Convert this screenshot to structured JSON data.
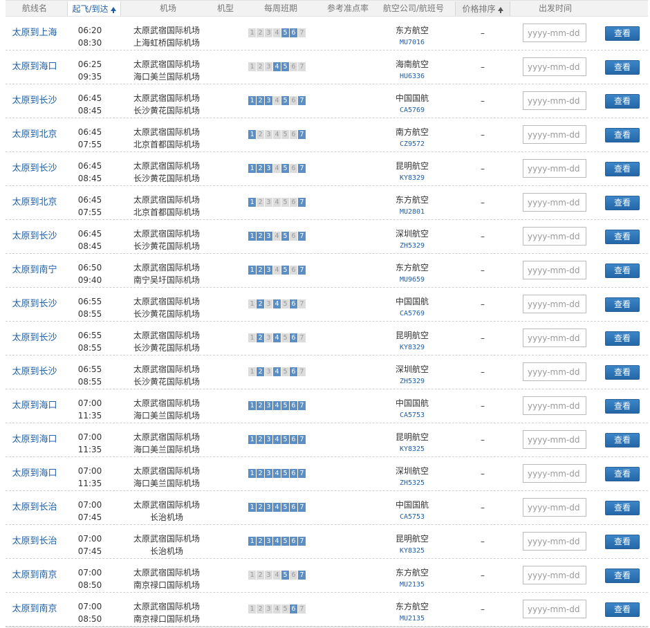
{
  "header": {
    "route": "航线名",
    "depart_arrive": "起飞/到达",
    "airport": "机场",
    "aircraft": "机型",
    "weekly": "每周班期",
    "ontime": "参考准点率",
    "airline_flight": "航空公司/航班号",
    "price_sort": "价格排序",
    "depart_date": "出发时间"
  },
  "date_placeholder": "yyyy-mm-dd",
  "view_label": "查看",
  "colors": {
    "link": "#1f5fa5",
    "day_on": "#5a8ec4",
    "day_off": "#dcdcdc",
    "button": "#2b6fb0"
  },
  "rows": [
    {
      "route": "太原到上海",
      "dep": "06:20",
      "arr": "08:30",
      "from": "太原武宿国际机场",
      "to": "上海虹桥国际机场",
      "days": [
        0,
        0,
        0,
        0,
        1,
        1,
        0
      ],
      "airline": "东方航空",
      "flight": "MU7016",
      "price": "–"
    },
    {
      "route": "太原到海口",
      "dep": "06:25",
      "arr": "09:35",
      "from": "太原武宿国际机场",
      "to": "海口美兰国际机场",
      "days": [
        0,
        0,
        0,
        1,
        1,
        0,
        0
      ],
      "airline": "海南航空",
      "flight": "HU6336",
      "price": "–"
    },
    {
      "route": "太原到长沙",
      "dep": "06:45",
      "arr": "08:45",
      "from": "太原武宿国际机场",
      "to": "长沙黄花国际机场",
      "days": [
        1,
        1,
        1,
        0,
        1,
        0,
        1
      ],
      "airline": "中国国航",
      "flight": "CA5769",
      "price": "–"
    },
    {
      "route": "太原到北京",
      "dep": "06:45",
      "arr": "07:55",
      "from": "太原武宿国际机场",
      "to": "北京首都国际机场",
      "days": [
        1,
        0,
        0,
        0,
        0,
        0,
        1
      ],
      "airline": "南方航空",
      "flight": "CZ9572",
      "price": "–"
    },
    {
      "route": "太原到长沙",
      "dep": "06:45",
      "arr": "08:45",
      "from": "太原武宿国际机场",
      "to": "长沙黄花国际机场",
      "days": [
        1,
        1,
        1,
        0,
        1,
        0,
        1
      ],
      "airline": "昆明航空",
      "flight": "KY8329",
      "price": "–"
    },
    {
      "route": "太原到北京",
      "dep": "06:45",
      "arr": "07:55",
      "from": "太原武宿国际机场",
      "to": "北京首都国际机场",
      "days": [
        1,
        0,
        0,
        0,
        0,
        0,
        1
      ],
      "airline": "东方航空",
      "flight": "MU2801",
      "price": "–"
    },
    {
      "route": "太原到长沙",
      "dep": "06:45",
      "arr": "08:45",
      "from": "太原武宿国际机场",
      "to": "长沙黄花国际机场",
      "days": [
        1,
        1,
        1,
        0,
        1,
        0,
        1
      ],
      "airline": "深圳航空",
      "flight": "ZH5329",
      "price": "–"
    },
    {
      "route": "太原到南宁",
      "dep": "06:50",
      "arr": "09:40",
      "from": "太原武宿国际机场",
      "to": "南宁吴圩国际机场",
      "days": [
        1,
        1,
        1,
        0,
        1,
        0,
        1
      ],
      "airline": "东方航空",
      "flight": "MU9659",
      "price": "–"
    },
    {
      "route": "太原到长沙",
      "dep": "06:55",
      "arr": "08:55",
      "from": "太原武宿国际机场",
      "to": "长沙黄花国际机场",
      "days": [
        0,
        1,
        0,
        1,
        0,
        1,
        0
      ],
      "airline": "中国国航",
      "flight": "CA5769",
      "price": "–"
    },
    {
      "route": "太原到长沙",
      "dep": "06:55",
      "arr": "08:55",
      "from": "太原武宿国际机场",
      "to": "长沙黄花国际机场",
      "days": [
        0,
        1,
        0,
        1,
        0,
        1,
        0
      ],
      "airline": "昆明航空",
      "flight": "KY8329",
      "price": "–"
    },
    {
      "route": "太原到长沙",
      "dep": "06:55",
      "arr": "08:55",
      "from": "太原武宿国际机场",
      "to": "长沙黄花国际机场",
      "days": [
        0,
        1,
        0,
        1,
        0,
        1,
        0
      ],
      "airline": "深圳航空",
      "flight": "ZH5329",
      "price": "–"
    },
    {
      "route": "太原到海口",
      "dep": "07:00",
      "arr": "11:35",
      "from": "太原武宿国际机场",
      "to": "海口美兰国际机场",
      "days": [
        1,
        1,
        1,
        1,
        1,
        1,
        1
      ],
      "airline": "中国国航",
      "flight": "CA5753",
      "price": "–"
    },
    {
      "route": "太原到海口",
      "dep": "07:00",
      "arr": "11:35",
      "from": "太原武宿国际机场",
      "to": "海口美兰国际机场",
      "days": [
        1,
        1,
        1,
        1,
        1,
        1,
        1
      ],
      "airline": "昆明航空",
      "flight": "KY8325",
      "price": "–"
    },
    {
      "route": "太原到海口",
      "dep": "07:00",
      "arr": "11:35",
      "from": "太原武宿国际机场",
      "to": "海口美兰国际机场",
      "days": [
        1,
        1,
        1,
        1,
        1,
        1,
        1
      ],
      "airline": "深圳航空",
      "flight": "ZH5325",
      "price": "–"
    },
    {
      "route": "太原到长治",
      "dep": "07:00",
      "arr": "07:45",
      "from": "太原武宿国际机场",
      "to": "长治机场",
      "days": [
        1,
        1,
        1,
        1,
        1,
        1,
        1
      ],
      "airline": "中国国航",
      "flight": "CA5753",
      "price": "–"
    },
    {
      "route": "太原到长治",
      "dep": "07:00",
      "arr": "07:45",
      "from": "太原武宿国际机场",
      "to": "长治机场",
      "days": [
        1,
        1,
        1,
        1,
        1,
        1,
        1
      ],
      "airline": "昆明航空",
      "flight": "KY8325",
      "price": "–"
    },
    {
      "route": "太原到南京",
      "dep": "07:00",
      "arr": "08:50",
      "from": "太原武宿国际机场",
      "to": "南京禄口国际机场",
      "days": [
        0,
        0,
        0,
        0,
        1,
        0,
        1
      ],
      "airline": "东方航空",
      "flight": "MU2135",
      "price": "–"
    },
    {
      "route": "太原到南京",
      "dep": "07:00",
      "arr": "08:50",
      "from": "太原武宿国际机场",
      "to": "南京禄口国际机场",
      "days": [
        0,
        0,
        0,
        0,
        0,
        1,
        0
      ],
      "airline": "东方航空",
      "flight": "MU2135",
      "price": "–"
    }
  ]
}
